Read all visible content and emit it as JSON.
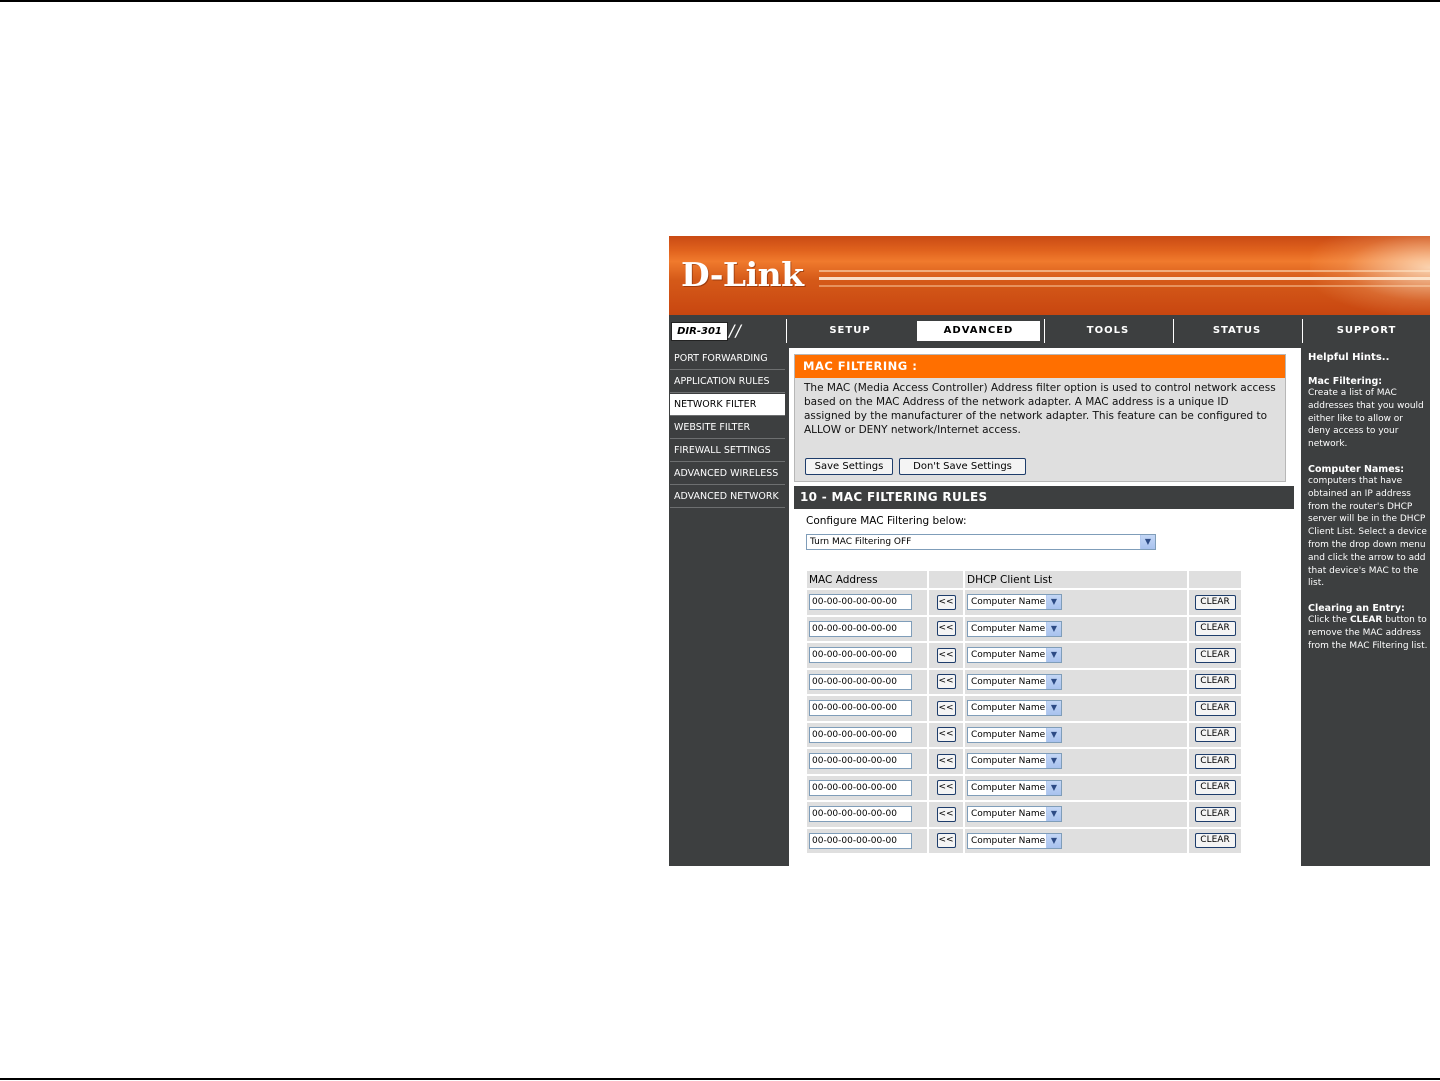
{
  "brand": {
    "logo": "D-Link",
    "model": "DIR-301"
  },
  "nav": {
    "tabs": [
      {
        "label": "SETUP"
      },
      {
        "label": "ADVANCED"
      },
      {
        "label": "TOOLS"
      },
      {
        "label": "STATUS"
      },
      {
        "label": "SUPPORT"
      }
    ],
    "active_tab": "ADVANCED"
  },
  "sidebar": {
    "items": [
      {
        "label": "PORT FORWARDING"
      },
      {
        "label": "APPLICATION RULES"
      },
      {
        "label": "NETWORK FILTER"
      },
      {
        "label": "WEBSITE FILTER"
      },
      {
        "label": "FIREWALL SETTINGS"
      },
      {
        "label": "ADVANCED WIRELESS"
      },
      {
        "label": "ADVANCED NETWORK"
      }
    ],
    "active_item": "NETWORK FILTER"
  },
  "mac_filtering": {
    "title": "MAC FILTERING :",
    "description": "The MAC (Media Access Controller) Address filter option is used to control network access based on the MAC Address of the network adapter. A MAC address is a unique ID assigned by the manufacturer of the network adapter. This feature can be configured to ALLOW or DENY network/Internet access.",
    "save_label": "Save Settings",
    "dont_save_label": "Don't Save Settings"
  },
  "rules": {
    "title": "10 - MAC FILTERING RULES",
    "configure_label": "Configure MAC Filtering below:",
    "mode_value": "Turn MAC Filtering OFF",
    "headers": {
      "mac": "MAC Address",
      "dhcp": "DHCP Client List"
    },
    "copy_label": "<<",
    "clear_label": "CLEAR",
    "rows": [
      {
        "mac": "00-00-00-00-00-00",
        "client": "Computer Name"
      },
      {
        "mac": "00-00-00-00-00-00",
        "client": "Computer Name"
      },
      {
        "mac": "00-00-00-00-00-00",
        "client": "Computer Name"
      },
      {
        "mac": "00-00-00-00-00-00",
        "client": "Computer Name"
      },
      {
        "mac": "00-00-00-00-00-00",
        "client": "Computer Name"
      },
      {
        "mac": "00-00-00-00-00-00",
        "client": "Computer Name"
      },
      {
        "mac": "00-00-00-00-00-00",
        "client": "Computer Name"
      },
      {
        "mac": "00-00-00-00-00-00",
        "client": "Computer Name"
      },
      {
        "mac": "00-00-00-00-00-00",
        "client": "Computer Name"
      },
      {
        "mac": "00-00-00-00-00-00",
        "client": "Computer Name"
      }
    ]
  },
  "hints": {
    "title": "Helpful Hints..",
    "sections": [
      {
        "heading": "Mac Filtering:",
        "text": "Create a list of MAC addresses that you would either like to allow or deny access to your network."
      },
      {
        "heading": "Computer Names:",
        "text": "computers that have obtained an IP address from the router's DHCP server will be in the DHCP Client List. Select a device from the drop down menu and click the arrow to add that device's MAC to the list."
      },
      {
        "heading": "Clearing an Entry:",
        "text_before": "Click the ",
        "text_bold": "CLEAR",
        "text_after": " button to remove the MAC address from the MAC Filtering list."
      }
    ]
  },
  "colors": {
    "brand_orange": "#ff6f00",
    "dark_gray": "#3d3f40",
    "panel_gray": "#dfdfdf"
  }
}
